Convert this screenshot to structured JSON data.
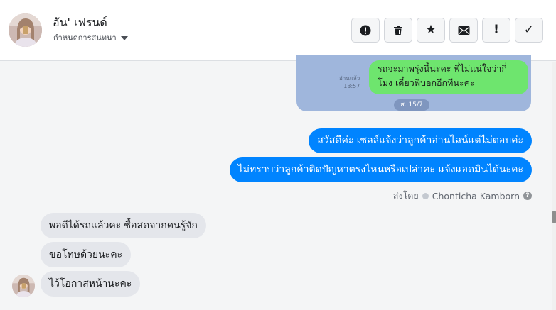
{
  "contact": {
    "name": "อัน' เฟรนด์",
    "subtitle": "กำหนดการสนทนา"
  },
  "toolbar": {
    "buttons": [
      {
        "icon": "alert-circle-icon",
        "glyph": "!"
      },
      {
        "icon": "trash-icon",
        "glyph": ""
      },
      {
        "icon": "star-icon",
        "glyph": "★"
      },
      {
        "icon": "envelope-icon",
        "glyph": ""
      },
      {
        "icon": "exclamation-icon",
        "glyph": "!"
      },
      {
        "icon": "checkmark-icon",
        "glyph": "✓"
      }
    ]
  },
  "attachment": {
    "bubble_text": "รถจะมาพรุ่งนี้นะคะ พี่ไม่แน่ใจว่ากี่โมง เดี๋ยวพี่บอกอีกทีนะคะ",
    "read_label": "อ่านแล้ว",
    "time": "13:57",
    "date_badge": "ส. 15/7"
  },
  "messages_out": [
    "สวัสดีค่ะ เซลล์แจ้งว่าลูกค้าอ่านไลน์แต่ไม่ตอบค่ะ",
    "ไม่ทราบว่าลูกค้าติดปัญหาตรงไหนหรือเปล่าคะ แจ้งแอดมินได้นะคะ"
  ],
  "sent_by": {
    "prefix": "ส่งโดย",
    "name": "Chonticha Kamborn",
    "help": "?"
  },
  "messages_in": [
    "พอดีได้รถแล้วคะ ซื้อสดจากคนรู้จัก",
    "ขอโทษด้วยนะคะ",
    "ไว้โอกาสหน้านะคะ"
  ],
  "colors": {
    "outgoing_bubble": "#0084ff",
    "incoming_bubble": "#e4e6eb",
    "line_bubble": "#6ee56e",
    "attachment_bg": "#9fb6dc"
  }
}
